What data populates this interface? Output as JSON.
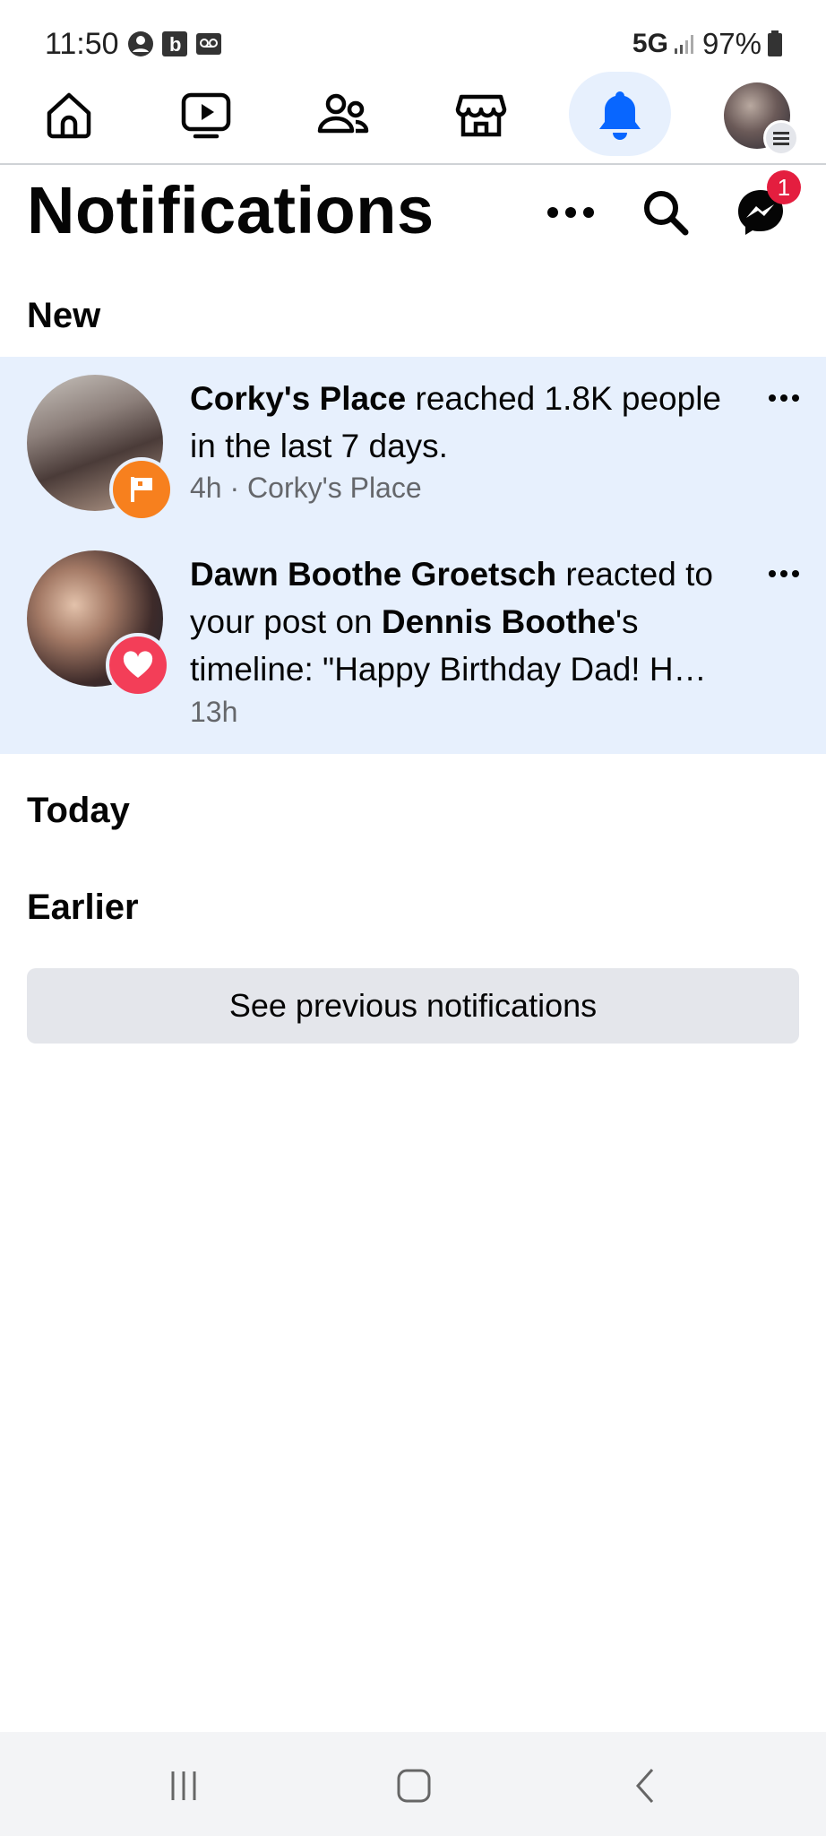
{
  "status_bar": {
    "time": "11:50",
    "network": "5G",
    "battery": "97%"
  },
  "top_nav": {
    "items": [
      {
        "name": "home",
        "icon": "home-icon"
      },
      {
        "name": "watch",
        "icon": "video-icon"
      },
      {
        "name": "friends",
        "icon": "friends-icon"
      },
      {
        "name": "marketplace",
        "icon": "store-icon"
      },
      {
        "name": "notifications",
        "icon": "bell-icon",
        "active": true
      },
      {
        "name": "menu",
        "icon": "profile-avatar"
      }
    ],
    "accent_color": "#0866ff"
  },
  "header": {
    "title": "Notifications",
    "messenger_badge": "1"
  },
  "sections": {
    "new_label": "New",
    "today_label": "Today",
    "earlier_label": "Earlier"
  },
  "notifications": [
    {
      "actor": "Corky's Place",
      "text": " reached 1.8K people in the last 7 days.",
      "meta": "4h · Corky's Place",
      "badge_icon": "flag-icon",
      "badge_color": "#f7801e"
    },
    {
      "actor": "Dawn Boothe Groetsch",
      "text_a": " reacted to your post on ",
      "target": "Dennis Boothe",
      "text_b": "'s timeline: \"Happy Birthday Dad! H…",
      "meta": "13h",
      "badge_icon": "heart-icon",
      "badge_color": "#f33e58"
    }
  ],
  "see_previous_label": "See previous notifications",
  "colors": {
    "unread_bg": "#e7f0fd",
    "button_bg": "#e4e6eb",
    "badge_red": "#e41e3f"
  }
}
